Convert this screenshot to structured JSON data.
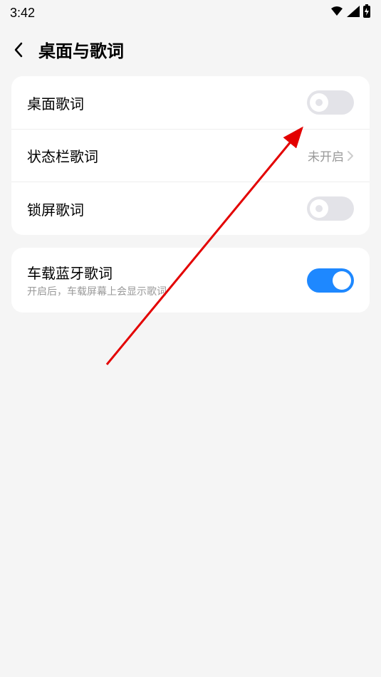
{
  "status_bar": {
    "time": "3:42"
  },
  "header": {
    "title": "桌面与歌词"
  },
  "group1": {
    "items": [
      {
        "label": "桌面歌词",
        "type": "toggle",
        "on": false
      },
      {
        "label": "状态栏歌词",
        "type": "nav",
        "value": "未开启"
      },
      {
        "label": "锁屏歌词",
        "type": "toggle",
        "on": false
      }
    ]
  },
  "group2": {
    "items": [
      {
        "label": "车载蓝牙歌词",
        "sublabel": "开启后，车载屏幕上会显示歌词",
        "type": "toggle",
        "on": true
      }
    ]
  }
}
